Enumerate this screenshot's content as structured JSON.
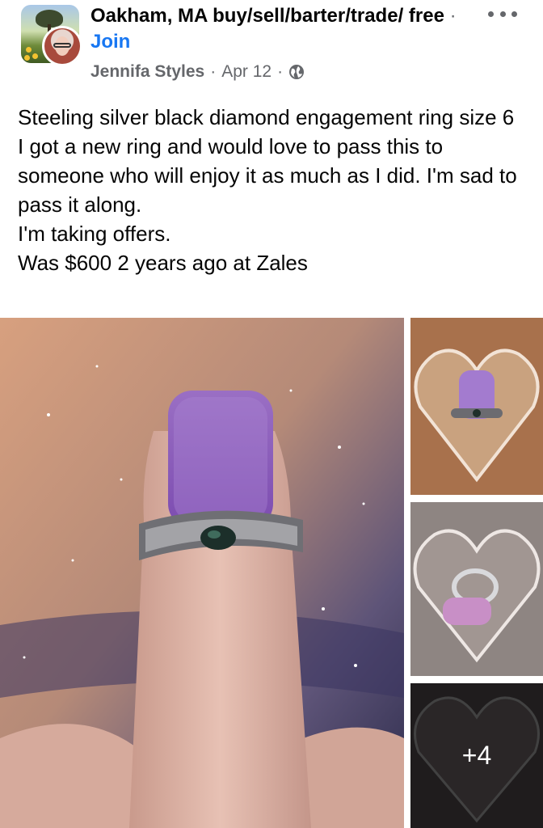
{
  "header": {
    "group_name": "Oakham, MA buy/sell/barter/trade/ free",
    "join_label": "Join",
    "separator": "·",
    "author": "Jennifa Styles",
    "date": "Apr 12",
    "privacy_icon": "globe-icon",
    "more_icon": "more-options-icon"
  },
  "post": {
    "lines": [
      "Steeling silver black diamond engagement ring size 6",
      "I got a new ring and would love to pass this to someone who will enjoy it as much as I did. I'm sad to pass it along.",
      "I'm taking offers.",
      "Was $600 2 years ago at Zales"
    ]
  },
  "photos": {
    "main": "ring-on-finger-photo",
    "thumbs": [
      "heart-collage-photo-1",
      "heart-collage-photo-2",
      "heart-collage-photo-3"
    ],
    "more_count": "+4"
  },
  "colors": {
    "link": "#1877f2",
    "secondary_text": "#65676b",
    "primary_text": "#050505"
  }
}
